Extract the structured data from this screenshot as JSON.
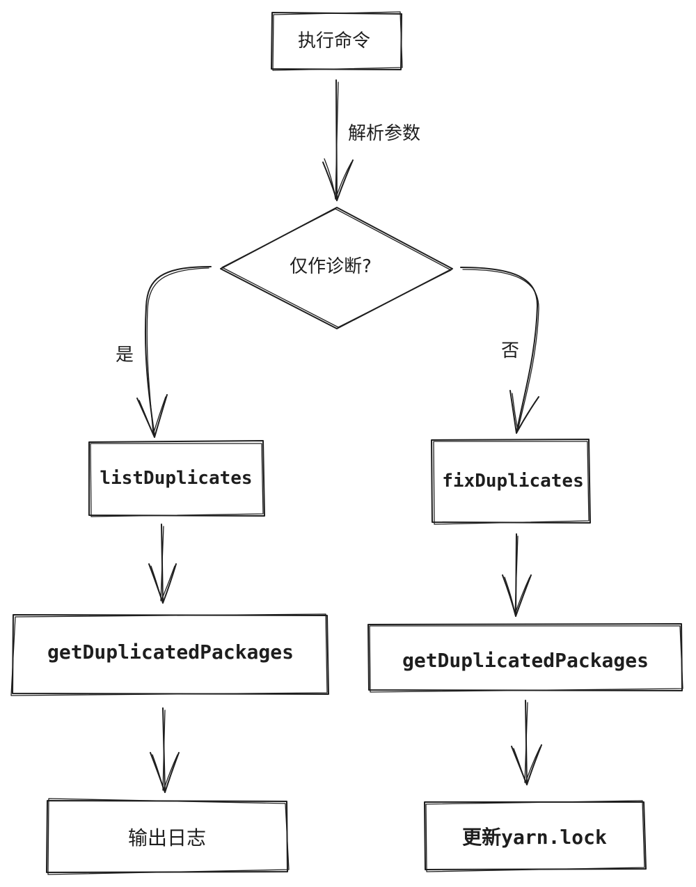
{
  "nodes": {
    "start": "执行命令",
    "decision": "仅作诊断?",
    "list": "listDuplicates",
    "fix": "fixDuplicates",
    "get_left": "getDuplicatedPackages",
    "get_right": "getDuplicatedPackages",
    "output": "输出日志",
    "update": "更新yarn.lock"
  },
  "edges": {
    "parse": "解析参数",
    "yes": "是",
    "no": "否"
  },
  "colors": {
    "stroke": "#1e1e1e",
    "background": "#ffffff"
  }
}
